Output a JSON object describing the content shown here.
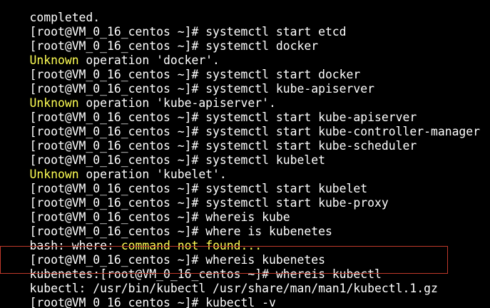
{
  "terminal": {
    "lines": [
      {
        "type": "partial",
        "text": "completed."
      },
      {
        "type": "cmd",
        "prompt": "[root@VM_0_16_centos ~]# ",
        "command": "systemctl start etcd"
      },
      {
        "type": "cmd",
        "prompt": "[root@VM_0_16_centos ~]# ",
        "command": "systemctl docker"
      },
      {
        "type": "error",
        "label": "Unknown",
        "rest": " operation 'docker'."
      },
      {
        "type": "cmd",
        "prompt": "[root@VM_0_16_centos ~]# ",
        "command": "systemctl start docker"
      },
      {
        "type": "cmd",
        "prompt": "[root@VM_0_16_centos ~]# ",
        "command": "systemctl kube-apiserver"
      },
      {
        "type": "error",
        "label": "Unknown",
        "rest": " operation 'kube-apiserver'."
      },
      {
        "type": "cmd",
        "prompt": "[root@VM_0_16_centos ~]# ",
        "command": "systemctl start kube-apiserver"
      },
      {
        "type": "cmd",
        "prompt": "[root@VM_0_16_centos ~]# ",
        "command": "systemctl start kube-controller-manager"
      },
      {
        "type": "cmd",
        "prompt": "[root@VM_0_16_centos ~]# ",
        "command": "systemctl start kube-scheduler"
      },
      {
        "type": "cmd",
        "prompt": "[root@VM_0_16_centos ~]# ",
        "command": "systemctl kubelet"
      },
      {
        "type": "error",
        "label": "Unknown",
        "rest": " operation 'kubelet'."
      },
      {
        "type": "cmd",
        "prompt": "[root@VM_0_16_centos ~]# ",
        "command": "systemctl start kubelet"
      },
      {
        "type": "cmd",
        "prompt": "[root@VM_0_16_centos ~]# ",
        "command": "systemctl start kube-proxy"
      },
      {
        "type": "cmd",
        "prompt": "[root@VM_0_16_centos ~]# ",
        "command": "whereis kube"
      },
      {
        "type": "cmd",
        "prompt": "[root@VM_0_16_centos ~]# ",
        "command": "where is kubenetes"
      },
      {
        "type": "bash_error",
        "prefix": "bash: where: ",
        "message": "command not found..."
      },
      {
        "type": "cmd",
        "prompt": "[root@VM_0_16_centos ~]# ",
        "command": "whereis kubenetes"
      },
      {
        "type": "cmd",
        "prompt": "kubenetes:[root@VM_0_16_centos ~]# ",
        "command": "whereis kubectl"
      },
      {
        "type": "output",
        "text": "kubectl: /usr/bin/kubectl /usr/share/man/man1/kubectl.1.gz"
      },
      {
        "type": "cmd",
        "prompt": "[root@VM_0_16_centos ~]# ",
        "command": "kubectl -v"
      }
    ]
  },
  "colors": {
    "background": "#000000",
    "text": "#ffffff",
    "warning": "#ffff54",
    "highlight_box": "#c0392b"
  }
}
